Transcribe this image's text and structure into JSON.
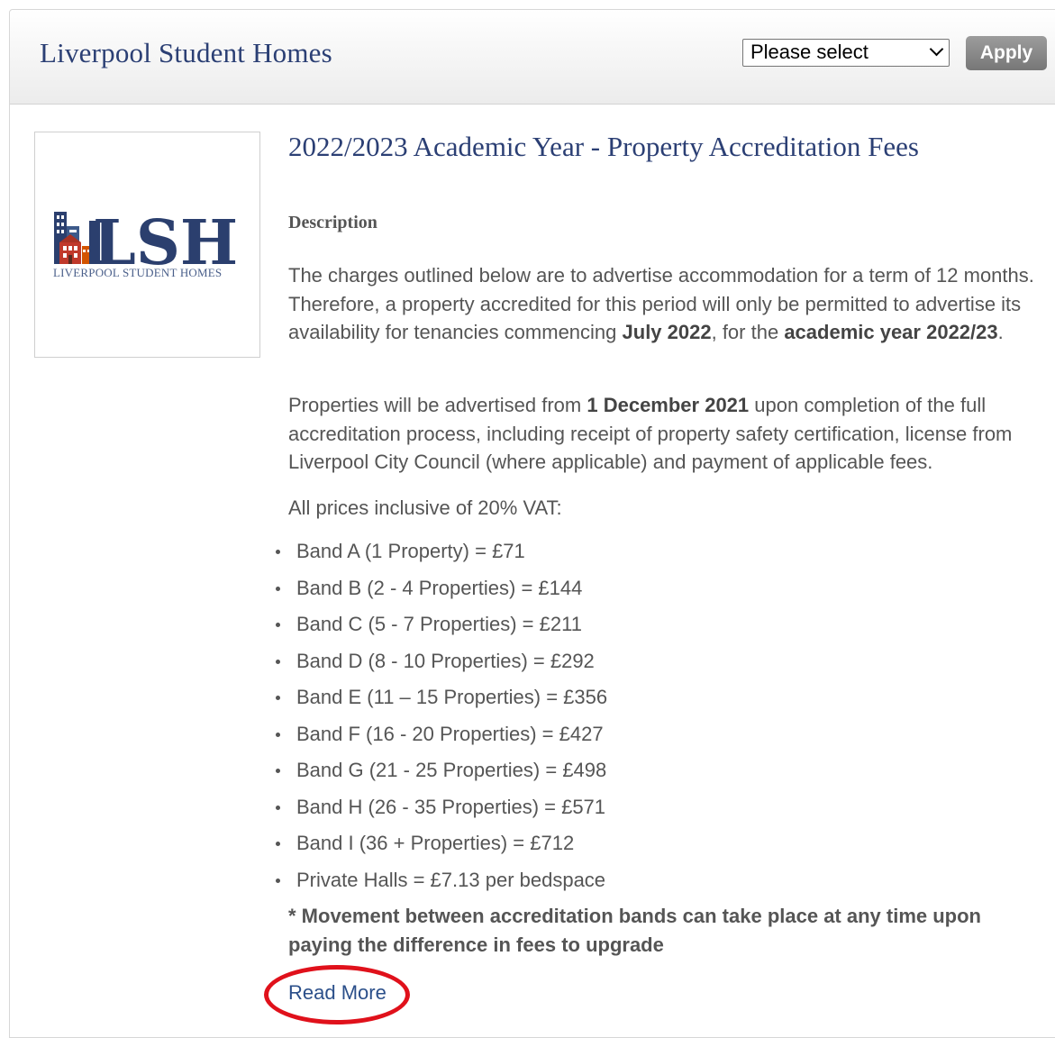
{
  "header": {
    "site_title": "Liverpool Student Homes",
    "select_value": "Please select",
    "apply_label": "Apply"
  },
  "logo": {
    "letters": "LSH",
    "subtitle": "LIVERPOOL STUDENT HOMES",
    "brand_color": "#2b3f6e",
    "accent_color": "#c0392b"
  },
  "article": {
    "title": "2022/2023 Academic Year - Property Accreditation Fees",
    "description_label": "Description",
    "para1_a": "The charges outlined below are to advertise accommodation for a term of 12 months. Therefore, a property accredited for this period will only be permitted to advertise its availability for tenancies commencing ",
    "para1_b": "July 2022",
    "para1_c": ", for the ",
    "para1_d": "academic year 2022/23",
    "para1_e": ".",
    "para2_a": "Properties will be advertised from ",
    "para2_b": "1 December 2021",
    "para2_c": " upon completion of the full accreditation process, including receipt of property safety certification, license from Liverpool City Council (where applicable) and payment of applicable fees.",
    "vat_line": "All prices inclusive of 20% VAT:",
    "bands": [
      "Band A (1 Property) = £71",
      "Band B (2 - 4 Properties) = £144",
      "Band C (5 - 7 Properties) = £211",
      "Band D (8 - 10 Properties) = £292",
      "Band E (11 – 15 Properties) = £356",
      "Band F (16 - 20 Properties) = £427",
      "Band G (21 - 25 Properties) = £498",
      "Band H (26 - 35 Properties) = £571",
      "Band I (36 + Properties) = £712",
      "Private Halls = £7.13 per bedspace"
    ],
    "note": "* Movement between accreditation bands can take place at any time upon paying the difference in fees to upgrade",
    "read_more": "Read More"
  },
  "colors": {
    "title": "#2b3f74",
    "highlight": "#e0111b"
  }
}
